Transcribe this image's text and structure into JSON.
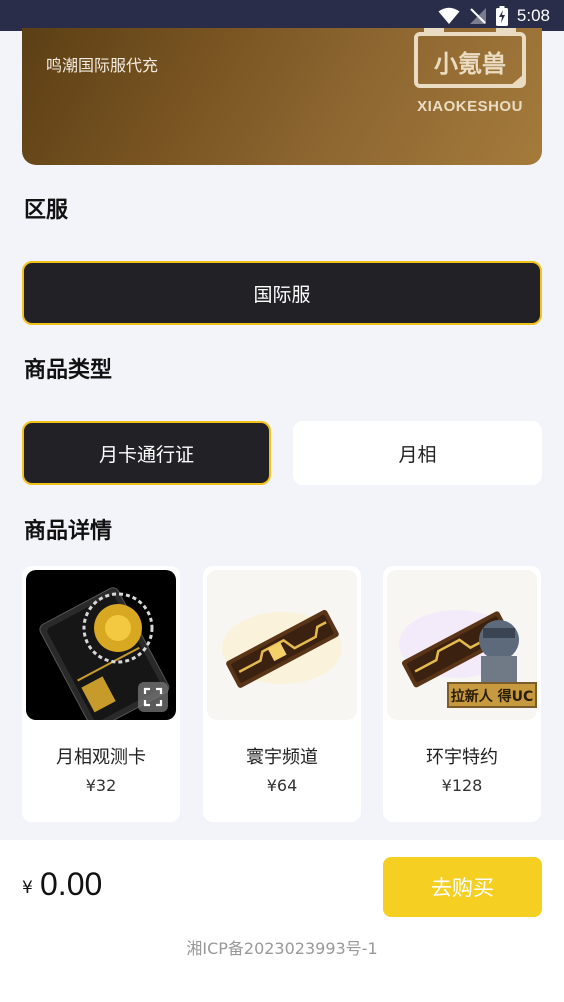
{
  "status_bar": {
    "time": "5:08"
  },
  "banner": {
    "subtitle": "鸣潮国际服代充",
    "logo_text": "XIAOKESHOU",
    "logo_glyphs": "小氪兽"
  },
  "region": {
    "title": "区服",
    "options": [
      {
        "label": "国际服",
        "selected": true
      }
    ]
  },
  "product_type": {
    "title": "商品类型",
    "options": [
      {
        "label": "月卡通行证",
        "selected": true
      },
      {
        "label": "月相",
        "selected": false
      }
    ]
  },
  "product_details": {
    "title": "商品详情",
    "items": [
      {
        "name": "月相观测卡",
        "price": "¥32"
      },
      {
        "name": "寰宇频道",
        "price": "¥64"
      },
      {
        "name": "环宇特约",
        "price": "¥128",
        "promo": "拉新人 得UC"
      }
    ]
  },
  "footer": {
    "currency_symbol": "¥",
    "total": "0.00",
    "buy_label": "去购买",
    "icp": "湘ICP备2023023993号-1"
  },
  "colors": {
    "accent": "#f6cf23",
    "selected_border": "#f2c21a",
    "dark_button": "#222226",
    "status_bar": "#2a2d4a"
  }
}
